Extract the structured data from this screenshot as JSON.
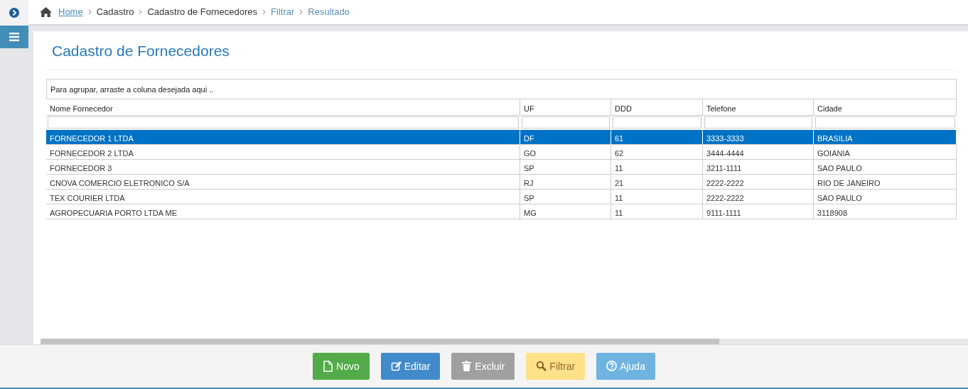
{
  "breadcrumb": [
    {
      "label": "Home",
      "kind": "link"
    },
    {
      "label": "Cadastro",
      "kind": "text"
    },
    {
      "label": "Cadastro de Fornecedores",
      "kind": "text"
    },
    {
      "label": "Filtrar",
      "kind": "muted"
    },
    {
      "label": "Resultado",
      "kind": "muted"
    }
  ],
  "page_title": "Cadastro de Fornecedores",
  "group_panel": "Para agrupar, arraste a coluna desejada aqui ..",
  "table": {
    "columns": [
      "Nome Fornecedor",
      "UF",
      "DDD",
      "Telefone",
      "Cidade"
    ],
    "rows": [
      {
        "selected": true,
        "cells": [
          "FORNECEDOR 1 LTDA",
          "DF",
          "61",
          "3333-3333",
          "BRASILIA"
        ]
      },
      {
        "selected": false,
        "cells": [
          "FORNECEDOR 2 LTDA",
          "GO",
          "62",
          "3444-4444",
          "GOIANIA"
        ]
      },
      {
        "selected": false,
        "cells": [
          "FORNECEDOR 3",
          "SP",
          "11",
          "3211-1111",
          "SAO PAULO"
        ]
      },
      {
        "selected": false,
        "cells": [
          "CNOVA COMERCIO ELETRONICO S/A",
          "RJ",
          "21",
          "2222-2222",
          "RIO DE JANEIRO"
        ]
      },
      {
        "selected": false,
        "cells": [
          "TEX COURIER LTDA",
          "SP",
          "11",
          "2222-2222",
          "SAO PAULO"
        ]
      },
      {
        "selected": false,
        "cells": [
          "AGROPECUARIA PORTO LTDA ME",
          "MG",
          "11",
          "9111-1111",
          "3118908"
        ]
      }
    ]
  },
  "buttons": [
    {
      "label": "Novo",
      "kind": "new"
    },
    {
      "label": "Editar",
      "kind": "edit"
    },
    {
      "label": "Excluir",
      "kind": "delete"
    },
    {
      "label": "Filtrar",
      "kind": "filter"
    },
    {
      "label": "Ajuda",
      "kind": "help"
    }
  ]
}
